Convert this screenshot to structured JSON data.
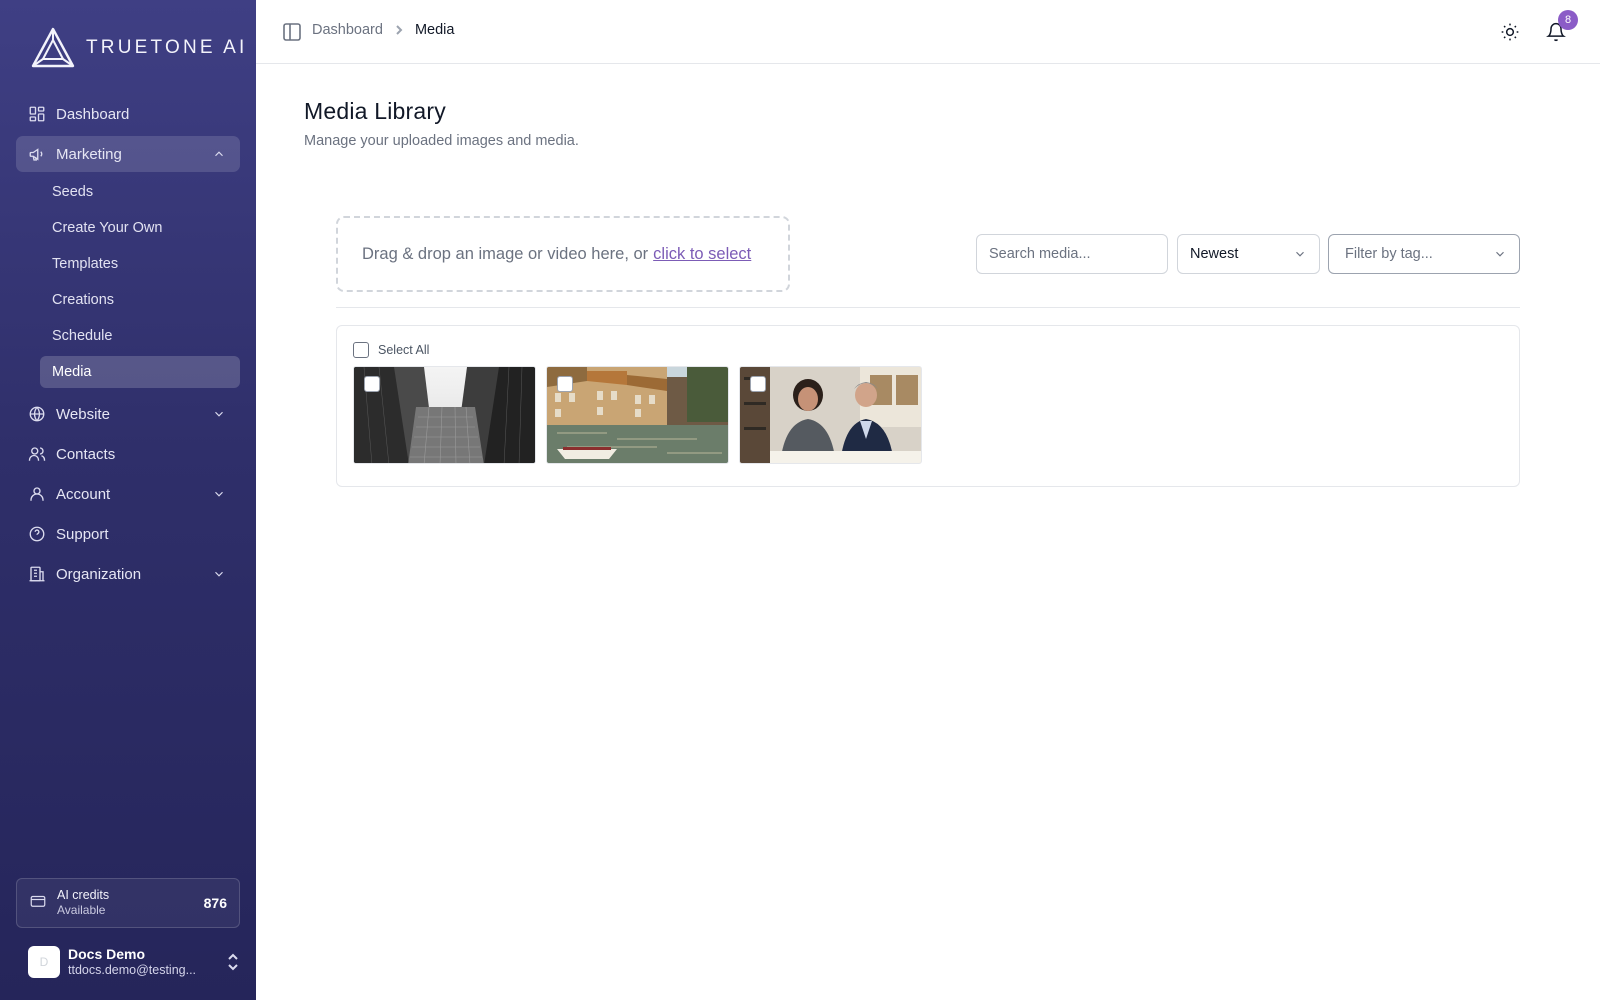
{
  "brand": {
    "name": "TRUETONE AI"
  },
  "sidebar": {
    "items": [
      {
        "label": "Dashboard",
        "icon": "dashboard-grid-icon"
      },
      {
        "label": "Marketing",
        "icon": "megaphone-icon",
        "expanded": true
      },
      {
        "label": "Website",
        "icon": "globe-icon"
      },
      {
        "label": "Contacts",
        "icon": "users-icon"
      },
      {
        "label": "Account",
        "icon": "user-icon"
      },
      {
        "label": "Support",
        "icon": "help-circle-icon"
      },
      {
        "label": "Organization",
        "icon": "building-icon"
      }
    ],
    "marketing_sub": [
      {
        "label": "Seeds"
      },
      {
        "label": "Create Your Own"
      },
      {
        "label": "Templates"
      },
      {
        "label": "Creations"
      },
      {
        "label": "Schedule"
      },
      {
        "label": "Media",
        "active": true
      }
    ],
    "credits": {
      "title": "AI credits",
      "subtitle": "Available",
      "value": "876"
    },
    "user": {
      "name": "Docs Demo",
      "email": "ttdocs.demo@testing...",
      "avatar_initial": "D"
    }
  },
  "topbar": {
    "breadcrumb": {
      "parent": "Dashboard",
      "current": "Media"
    },
    "notifications_count": "8"
  },
  "main": {
    "title": "Media Library",
    "subtitle": "Manage your uploaded images and media.",
    "dropzone": {
      "text": "Drag & drop an image or video here, or",
      "link": "click to select"
    },
    "search": {
      "placeholder": "Search media...",
      "value": ""
    },
    "sort": {
      "value": "Newest"
    },
    "tag_filter": {
      "placeholder": "Filter by tag..."
    },
    "select_all_label": "Select All",
    "media": [
      {
        "subject": "skyscrapers looking up"
      },
      {
        "subject": "canal with old buildings"
      },
      {
        "subject": "two people meeting"
      }
    ]
  },
  "colors": {
    "sidebar": "#2f2f6a",
    "accent": "#8b5cc7",
    "link": "#7c5cb6"
  }
}
